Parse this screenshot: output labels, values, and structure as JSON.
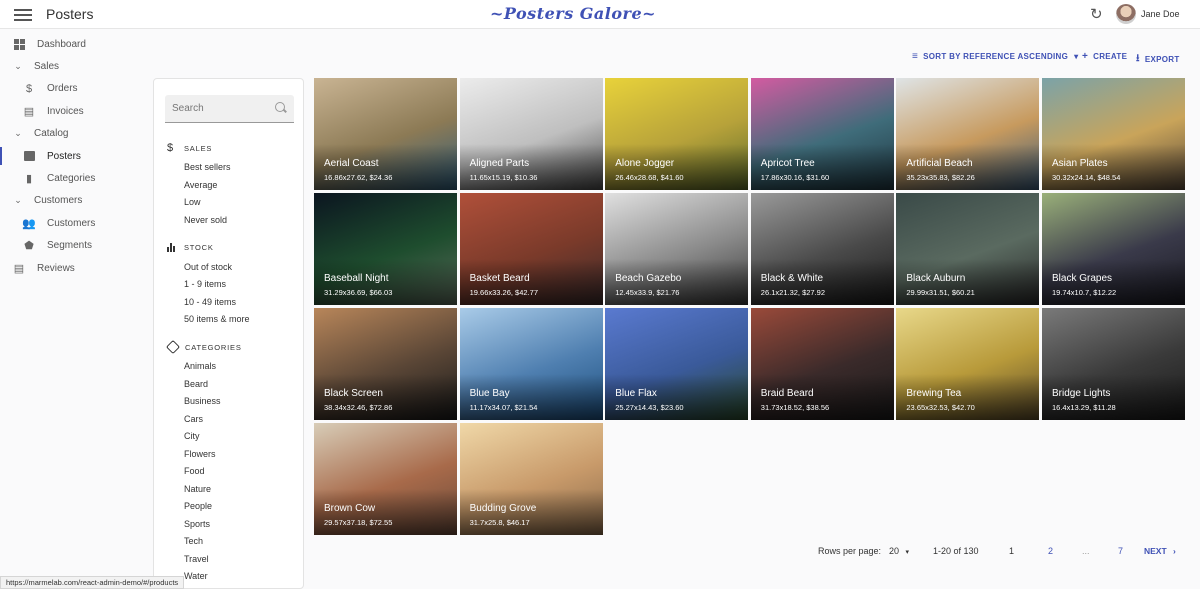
{
  "appbar": {
    "title": "Posters",
    "brand": "~Posters Galore~",
    "user": "Jane Doe"
  },
  "icons": {
    "menu": "menu-icon",
    "refresh": "refresh-icon",
    "refresh_glyph": "↻",
    "expand_glyph": "⌄",
    "dollar_glyph": "$",
    "people_glyph": "👥",
    "segment_glyph": "⬟",
    "review_glyph": "▤",
    "bookmark_glyph": "▮"
  },
  "nav": {
    "dashboard": "Dashboard",
    "sales": "Sales",
    "orders": "Orders",
    "invoices": "Invoices",
    "catalog": "Catalog",
    "posters": "Posters",
    "categories": "Categories",
    "customers_group": "Customers",
    "customers": "Customers",
    "segments": "Segments",
    "reviews": "Reviews"
  },
  "filters": {
    "search_placeholder": "Search",
    "sales": {
      "title": "SALES",
      "items": [
        "Best sellers",
        "Average",
        "Low",
        "Never sold"
      ]
    },
    "stock": {
      "title": "STOCK",
      "items": [
        "Out of stock",
        "1 - 9 items",
        "10 - 49 items",
        "50 items & more"
      ]
    },
    "categories": {
      "title": "CATEGORIES",
      "items": [
        "Animals",
        "Beard",
        "Business",
        "Cars",
        "City",
        "Flowers",
        "Food",
        "Nature",
        "People",
        "Sports",
        "Tech",
        "Travel",
        "Water"
      ]
    }
  },
  "toolbar": {
    "sort": "SORT BY REFERENCE ASCENDING",
    "create": "CREATE",
    "export": "EXPORT"
  },
  "posters": [
    {
      "name": "Aerial Coast",
      "desc": "16.86x27.62, $24.36",
      "colors": [
        "#c9b493",
        "#8c7a55",
        "#2f5d7a"
      ]
    },
    {
      "name": "Aligned Parts",
      "desc": "11.65x15.19, $10.36",
      "colors": [
        "#ececec",
        "#bfbfbf",
        "#4a4a4a"
      ]
    },
    {
      "name": "Alone Jogger",
      "desc": "26.46x28.68, $41.60",
      "colors": [
        "#e8d23a",
        "#b7a23a",
        "#5c6b2a"
      ]
    },
    {
      "name": "Apricot Tree",
      "desc": "17.86x30.16, $31.60",
      "colors": [
        "#d35ba1",
        "#3f6c7a",
        "#1f3640"
      ]
    },
    {
      "name": "Artificial Beach",
      "desc": "35.23x35.83, $82.26",
      "colors": [
        "#dfe4e6",
        "#c79a5e",
        "#3a5a78"
      ]
    },
    {
      "name": "Asian Plates",
      "desc": "30.32x24.14, $48.54",
      "colors": [
        "#7ba3a8",
        "#c9a45a",
        "#5a4a3a"
      ]
    },
    {
      "name": "Baseball Night",
      "desc": "31.29x36.69, $66.03",
      "colors": [
        "#0b1520",
        "#1e4d2e",
        "#5a6a5a"
      ]
    },
    {
      "name": "Basket Beard",
      "desc": "19.66x33.26, $42.77",
      "colors": [
        "#b0503a",
        "#7a3a2a",
        "#3a2a2a"
      ]
    },
    {
      "name": "Beach Gazebo",
      "desc": "12.45x33.9, $21.76",
      "colors": [
        "#e0e0e0",
        "#8a8a8a",
        "#3a3a3a"
      ]
    },
    {
      "name": "Black & White",
      "desc": "26.1x21.32, $27.92",
      "colors": [
        "#9a9a9a",
        "#4a4a4a",
        "#1a1a1a"
      ]
    },
    {
      "name": "Black Auburn",
      "desc": "29.99x31.51, $60.21",
      "colors": [
        "#3a4a48",
        "#5a6a60",
        "#2a2a2a"
      ]
    },
    {
      "name": "Black Grapes",
      "desc": "19.74x10.7, $12.22",
      "colors": [
        "#9ab07a",
        "#3a3a4a",
        "#1a1a22"
      ]
    },
    {
      "name": "Black Screen",
      "desc": "38.34x32.46, $72.86",
      "colors": [
        "#b8865a",
        "#5a4636",
        "#1a1a1a"
      ]
    },
    {
      "name": "Blue Bay",
      "desc": "11.17x34.07, $21.54",
      "colors": [
        "#a9cbe8",
        "#4f7fb0",
        "#1d4f7e"
      ]
    },
    {
      "name": "Blue Flax",
      "desc": "25.27x14.43, $23.60",
      "colors": [
        "#5a7ad0",
        "#3a5a9a",
        "#2a4a2a"
      ]
    },
    {
      "name": "Braid Beard",
      "desc": "31.73x18.52, $38.56",
      "colors": [
        "#9a4a3a",
        "#3a2a2a",
        "#1a1a1a"
      ]
    },
    {
      "name": "Brewing Tea",
      "desc": "23.65x32.53, $42.70",
      "colors": [
        "#e8d88a",
        "#b89a3a",
        "#5a4a2a"
      ]
    },
    {
      "name": "Bridge Lights",
      "desc": "16.4x13.29, $11.28",
      "colors": [
        "#7a7a7a",
        "#3a3a3a",
        "#1a1a1a"
      ]
    },
    {
      "name": "Brown Cow",
      "desc": "29.57x37.18, $72.55",
      "colors": [
        "#d8cdb8",
        "#a86a4a",
        "#6a4a3a"
      ]
    },
    {
      "name": "Budding Grove",
      "desc": "31.7x25.8, $46.17",
      "colors": [
        "#f0d8a8",
        "#c89a6a",
        "#8a6a4a"
      ]
    }
  ],
  "pagination": {
    "rows_label": "Rows per page:",
    "rows_value": "20",
    "range": "1-20 of 130",
    "pages": [
      "1",
      "2",
      "...",
      "7"
    ],
    "next": "NEXT"
  },
  "status_url": "https://marmelab.com/react-admin-demo/#/products"
}
